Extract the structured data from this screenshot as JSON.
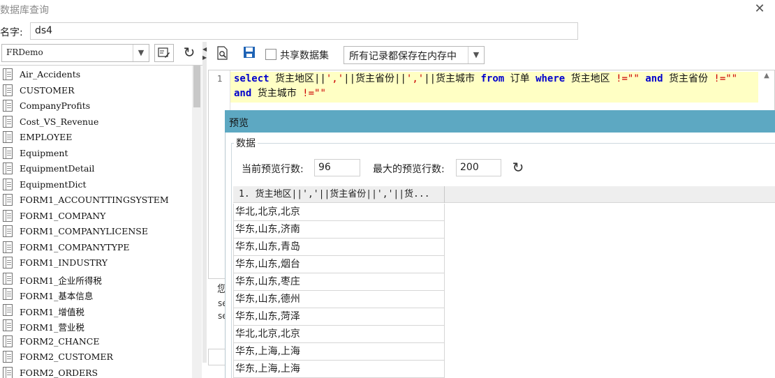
{
  "window": {
    "title": "数据库查询"
  },
  "name": {
    "label": "名字:",
    "value": "ds4"
  },
  "database": {
    "selected": "FRDemo"
  },
  "tables": [
    "Air_Accidents",
    "CUSTOMER",
    "CompanyProfits",
    "Cost_VS_Revenue",
    "EMPLOYEE",
    "Equipment",
    "EquipmentDetail",
    "EquipmentDict",
    "FORM1_ACCOUNTTINGSYSTEM",
    "FORM1_COMPANY",
    "FORM1_COMPANYLICENSE",
    "FORM1_COMPANYTYPE",
    "FORM1_INDUSTRY",
    "FORM1_企业所得税",
    "FORM1_基本信息",
    "FORM1_增值税",
    "FORM1_营业税",
    "FORM2_CHANCE",
    "FORM2_CUSTOMER",
    "FORM2_ORDERS"
  ],
  "toolbar": {
    "share_label": "共享数据集",
    "memory_option": "所有记录都保存在内存中"
  },
  "editor": {
    "line_number": "1",
    "tokens": {
      "select": "select",
      "p1": " 货主地区||",
      "s1": "','",
      "p2": "||货主省份||",
      "s2": "','",
      "p3": "||货主城市 ",
      "from": "from",
      "p4": " 订单 ",
      "where": "where",
      "p5": " 货主地区 ",
      "s3": "!=\"\"",
      "p6": " ",
      "and1": "and",
      "p7": " 货主省份 ",
      "s4": "!=\"\"",
      "p8": " ",
      "and2": "and",
      "p9": " 货主城市 ",
      "s5": "!=\"\""
    }
  },
  "lower_pane": {
    "c1": "您",
    "c2": "se",
    "c3": "se"
  },
  "preview": {
    "title": "预览",
    "group_label": "数据",
    "current_label": "当前预览行数:",
    "current_value": "96",
    "max_label": "最大的预览行数:",
    "max_value": "200",
    "column_header": "1. 货主地区||','||货主省份||','||货...",
    "rows": [
      "华北,北京,北京",
      "华东,山东,济南",
      "华东,山东,青岛",
      "华东,山东,烟台",
      "华东,山东,枣庄",
      "华东,山东,德州",
      "华东,山东,菏泽",
      "华北,北京,北京",
      "华东,上海,上海",
      "华东,上海,上海"
    ]
  }
}
